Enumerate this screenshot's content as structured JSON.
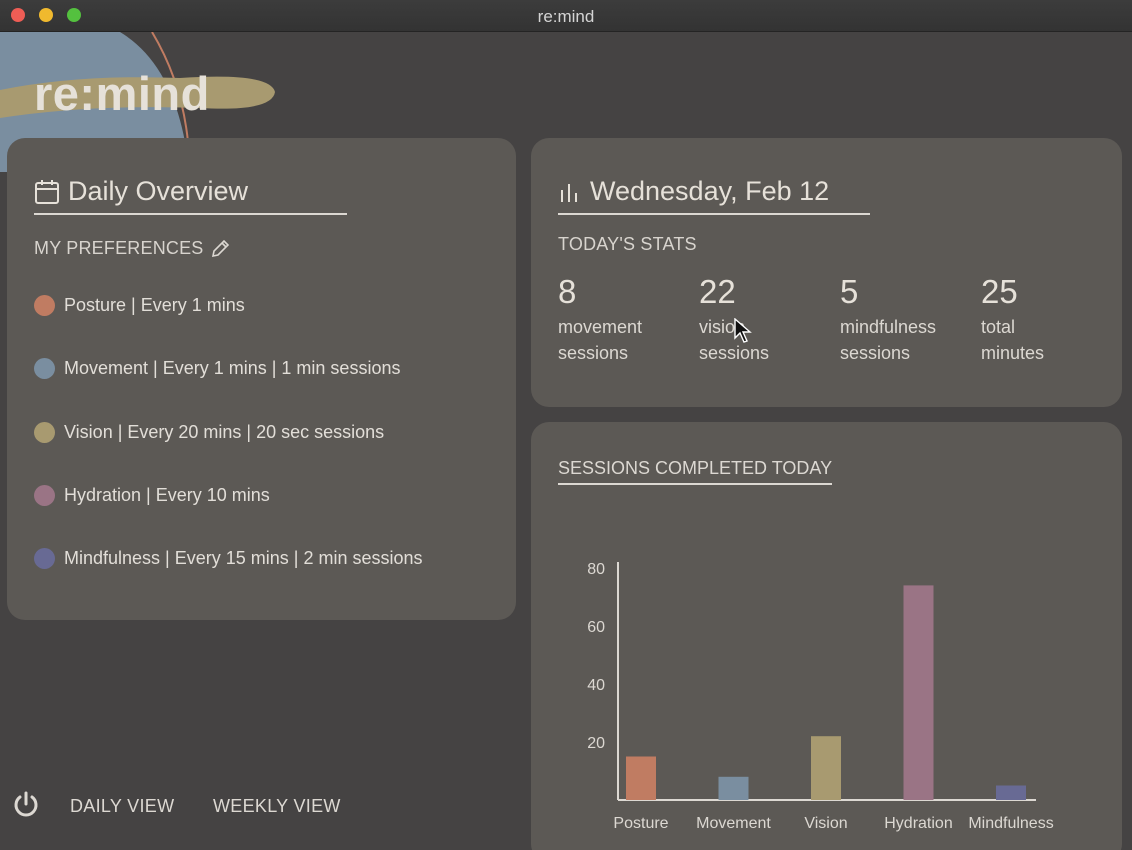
{
  "window": {
    "title": "re:mind"
  },
  "app": {
    "logo": "re:mind"
  },
  "daily_overview": {
    "title": "Daily Overview",
    "preferences_label": "MY PREFERENCES",
    "items": [
      {
        "label": "Posture | Every 1 mins",
        "color": "#c07c62"
      },
      {
        "label": "Movement | Every 1 mins | 1 min sessions",
        "color": "#7a8ea0"
      },
      {
        "label": "Vision | Every 20 mins | 20 sec sessions",
        "color": "#a89a70"
      },
      {
        "label": "Hydration | Every 10 mins",
        "color": "#9a7485"
      },
      {
        "label": "Mindfulness | Every 15 mins | 2 min sessions",
        "color": "#686a94"
      }
    ]
  },
  "stats": {
    "date": "Wednesday, Feb 12",
    "section_label": "TODAY'S STATS",
    "items": [
      {
        "value": "8",
        "label_line1": "movement",
        "label_line2": "sessions"
      },
      {
        "value": "22",
        "label_line1": "vision",
        "label_line2": "sessions"
      },
      {
        "value": "5",
        "label_line1": "mindfulness",
        "label_line2": "sessions"
      },
      {
        "value": "25",
        "label_line1": "total",
        "label_line2": "minutes"
      }
    ]
  },
  "chart": {
    "title": "SESSIONS COMPLETED TODAY"
  },
  "chart_data": {
    "type": "bar",
    "categories": [
      "Posture",
      "Movement",
      "Vision",
      "Hydration",
      "Mindfulness"
    ],
    "values": [
      15,
      8,
      22,
      74,
      5
    ],
    "colors": [
      "#c07c62",
      "#7a8ea0",
      "#a89a70",
      "#9a7485",
      "#686a94"
    ],
    "ylim": [
      0,
      80
    ],
    "yticks": [
      20,
      40,
      60,
      80
    ],
    "grid": false
  },
  "nav": {
    "daily": "DAILY VIEW",
    "weekly": "WEEKLY VIEW"
  }
}
